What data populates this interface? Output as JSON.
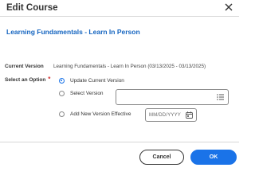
{
  "dialog": {
    "title": "Edit Course",
    "course_name": "Learning Fundamentals - Learn In Person"
  },
  "fields": {
    "current_version_label": "Current Version",
    "current_version_value": "Learning Fundamentals - Learn In Person (03/13/2025 - 03/13/2025)",
    "select_option_label": "Select an Option",
    "required_marker": "*"
  },
  "options": [
    {
      "label": "Update Current Version",
      "selected": true
    },
    {
      "label": "Select Version",
      "selected": false
    },
    {
      "label": "Add New Version Effective",
      "selected": false
    }
  ],
  "date_input": {
    "placeholder": "MM/DD/YYYY"
  },
  "buttons": {
    "cancel": "Cancel",
    "ok": "OK"
  },
  "colors": {
    "accent": "#1a73e8",
    "link": "#1565c0",
    "required": "#d32f2f"
  },
  "icons": {
    "close": "close-icon",
    "list": "list-icon",
    "calendar": "calendar-icon"
  }
}
